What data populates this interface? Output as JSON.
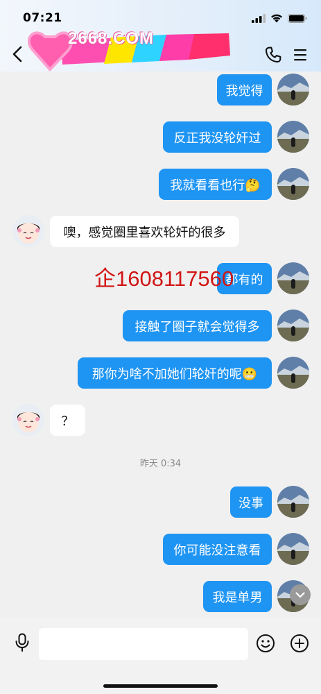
{
  "status_bar": {
    "time": "07:21"
  },
  "header": {
    "watermark_text": "2668.COM",
    "back_icon": "chevron-left-icon",
    "call_icon": "phone-icon",
    "menu_icon": "hamburger-menu-icon"
  },
  "messages": [
    {
      "side": "right",
      "text": "我觉得"
    },
    {
      "side": "right",
      "text": "反正我没轮奸过"
    },
    {
      "side": "right",
      "text": "我就看看也行🤔"
    },
    {
      "side": "left",
      "text": "噢，感觉圈里喜欢轮奸的很多"
    },
    {
      "side": "right",
      "text": "都有的"
    },
    {
      "side": "right",
      "text": "接触了圈子就会觉得多"
    },
    {
      "side": "right",
      "text": "那你为啥不加她们轮奸的呢😬"
    },
    {
      "side": "left",
      "text": "？"
    },
    {
      "side": "right",
      "text": "没事"
    },
    {
      "side": "right",
      "text": "你可能没注意看"
    },
    {
      "side": "right",
      "text": "我是单男"
    }
  ],
  "timestamp": "昨天 0:34",
  "overlay_ad": "企1608117560",
  "input_bar": {
    "placeholder": ""
  },
  "colors": {
    "outgoing_bubble": "#1e94f3",
    "incoming_bubble": "#ffffff",
    "background": "#f0f0f0",
    "ad_text": "#d11515"
  }
}
